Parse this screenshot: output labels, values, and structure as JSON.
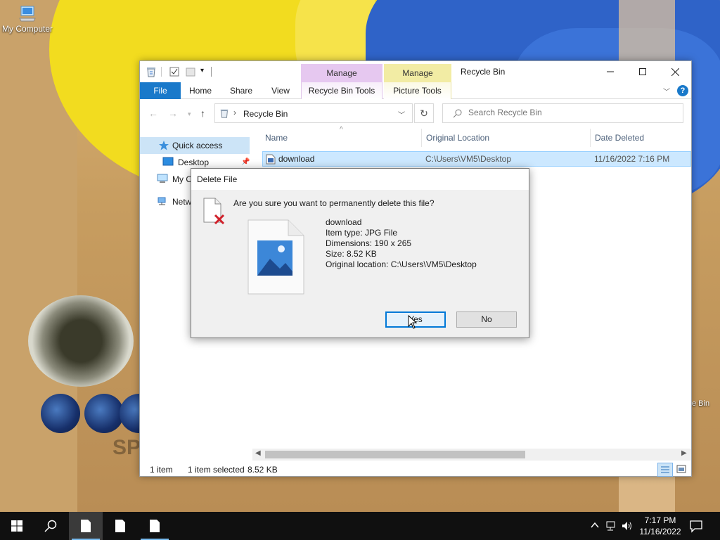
{
  "desktop": {
    "icons": [
      {
        "label": "My Computer"
      }
    ],
    "recycle_partial_label": "e Bin"
  },
  "wallpaper": {
    "text": "SP"
  },
  "explorer": {
    "title": "Recycle Bin",
    "context_tabs": {
      "recycle_bin_manage": "Manage",
      "picture_manage": "Manage"
    },
    "ribbon_tabs": {
      "file": "File",
      "home": "Home",
      "share": "Share",
      "view": "View",
      "recycle_bin_tools": "Recycle Bin Tools",
      "picture_tools": "Picture Tools"
    },
    "address": {
      "path": "Recycle Bin"
    },
    "search": {
      "placeholder": "Search Recycle Bin"
    },
    "nav": {
      "quick_access": "Quick access",
      "desktop": "Desktop",
      "my_computer": "My C",
      "network": "Netw"
    },
    "columns": {
      "name": "Name",
      "original_location": "Original Location",
      "date_deleted": "Date Deleted"
    },
    "rows": [
      {
        "name": "download",
        "original_location": "C:\\Users\\VM5\\Desktop",
        "date_deleted": "11/16/2022 7:16 PM"
      }
    ],
    "status": {
      "item_count": "1 item",
      "selection": "1 item selected",
      "size": "8.52 KB"
    }
  },
  "dialog": {
    "title": "Delete File",
    "question": "Are you sure you want to permanently delete this file?",
    "file": {
      "name": "download",
      "item_type": "Item type: JPG File",
      "dimensions": "Dimensions: 190 x 265",
      "size": "Size: 8.52 KB",
      "original_location": "Original location: C:\\Users\\VM5\\Desktop"
    },
    "buttons": {
      "yes": "Yes",
      "no": "No"
    }
  },
  "taskbar": {
    "clock": {
      "time": "7:17 PM",
      "date": "11/16/2022"
    }
  },
  "colors": {
    "accent": "#1979ca",
    "selection": "#cce8ff",
    "taskbar": "#101010",
    "manage_rb": "#e6c8f0",
    "manage_pic": "#f2eca4"
  }
}
